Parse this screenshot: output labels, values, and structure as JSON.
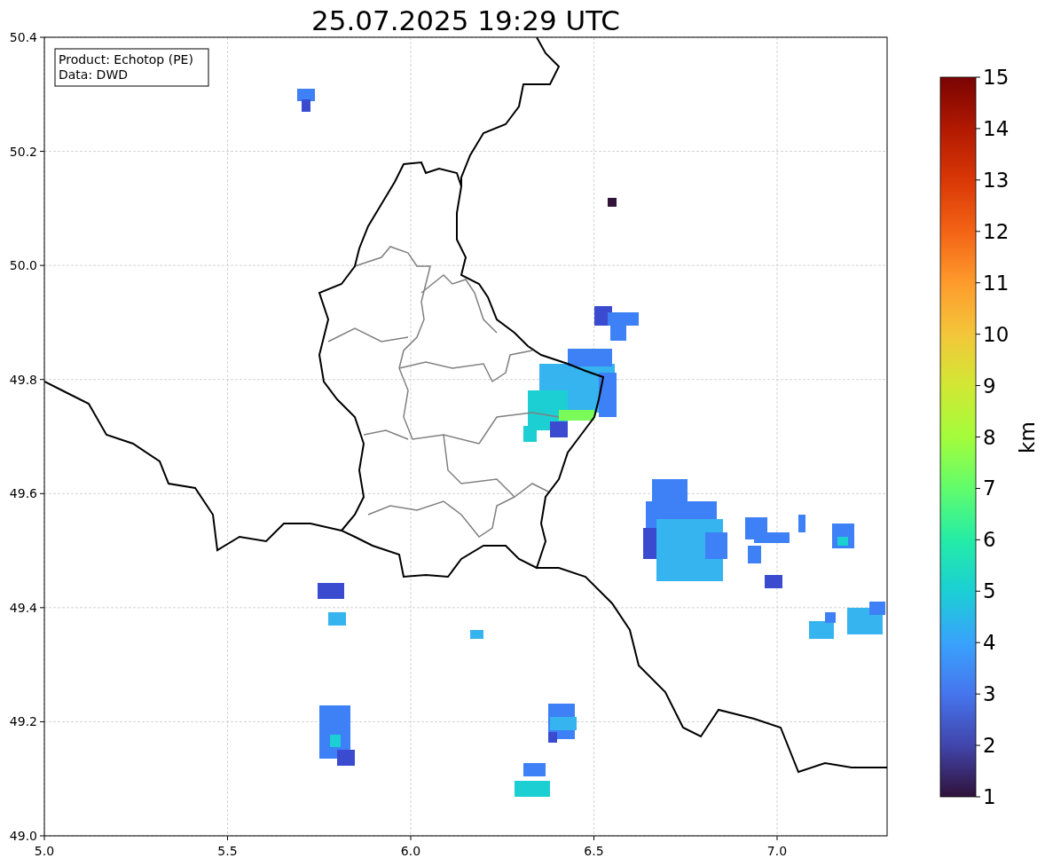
{
  "title": "25.07.2025 19:29 UTC",
  "info_box": {
    "lines": [
      "Product: Echotop (PE)",
      "Data: DWD"
    ]
  },
  "map": {
    "xticks": [
      "5.0",
      "5.5",
      "6.0",
      "6.5",
      "7.0"
    ],
    "yticks": [
      "50.4",
      "50.2",
      "50.0",
      "49.8",
      "49.6",
      "49.4",
      "49.2",
      "49.0"
    ]
  },
  "colorbar": {
    "label": "km",
    "ticks": [
      "15",
      "14",
      "13",
      "12",
      "11",
      "10",
      "9",
      "8",
      "7",
      "6",
      "5",
      "4",
      "3",
      "2",
      "1"
    ]
  }
}
